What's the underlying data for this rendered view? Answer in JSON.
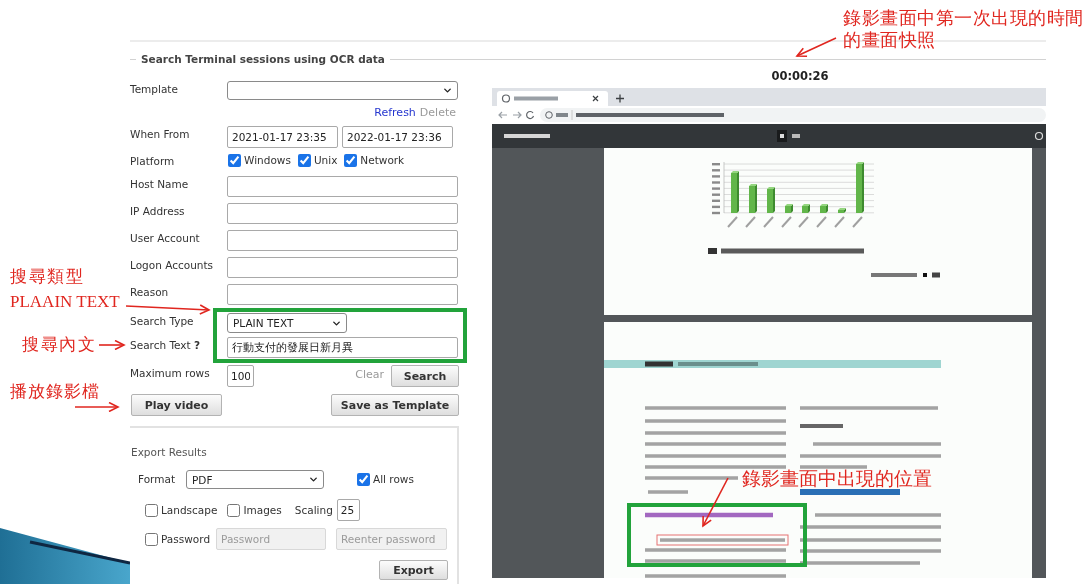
{
  "panel": {
    "title": "Search Terminal sessions using OCR data"
  },
  "form": {
    "fields": [
      {
        "kind": "select",
        "label": "Template",
        "highlighted": false
      },
      {
        "kind": "links",
        "links": [
          {
            "label": "Refresh",
            "disabled": false
          },
          {
            "label": "Delete",
            "disabled": true
          }
        ],
        "highlighted": false
      },
      {
        "kind": "date_range",
        "label": "When From",
        "values": [
          "2021-01-17 23:35",
          "2022-01-17 23:36"
        ],
        "highlighted": false
      },
      {
        "kind": "checkboxes",
        "label": "Platform",
        "options": [
          {
            "label": "Windows",
            "checked": true
          },
          {
            "label": "Unix",
            "checked": true
          },
          {
            "label": "Network",
            "checked": true
          }
        ],
        "highlighted": false
      },
      {
        "kind": "text",
        "label": "Host Name",
        "highlighted": false
      },
      {
        "kind": "text",
        "label": "IP Address",
        "highlighted": false
      },
      {
        "kind": "text",
        "label": "User Account",
        "highlighted": false
      },
      {
        "kind": "text",
        "label": "Logon Accounts",
        "highlighted": false
      },
      {
        "kind": "text",
        "label": "Reason",
        "highlighted": false
      },
      {
        "kind": "select",
        "label": "Search Type",
        "value": "PLAIN TEXT",
        "highlighted": true
      },
      {
        "kind": "text",
        "label": "Search Text **?**",
        "value": "行動支付的發展日新月異",
        "highlighted": true
      },
      {
        "kind": "max_rows",
        "label": "Maximum rows",
        "value": "100",
        "link": {
          "label": "Clear",
          "disabled": true
        },
        "button": "Search",
        "highlighted": false
      }
    ],
    "buttons": [
      {
        "label": "Play video"
      },
      {
        "label": "Save as Template"
      }
    ]
  },
  "export": {
    "title": "Export Results",
    "format": {
      "label": "Format",
      "value": "PDF"
    },
    "all_rows": {
      "label": "All rows",
      "checked": true
    },
    "options": [
      {
        "label": "Landscape",
        "checked": false
      },
      {
        "label": "Images",
        "checked": false
      }
    ],
    "scaling": {
      "label": "Scaling",
      "value": "25"
    },
    "password": {
      "label": "Password",
      "checked": false
    },
    "password_fields": [
      {
        "placeholder": "Password",
        "disabled": true
      },
      {
        "placeholder": "Reenter password",
        "disabled": true
      }
    ],
    "button": "Export"
  },
  "video": {
    "timestamp": "00:00:26"
  },
  "annotations": [
    {
      "text": "錄影畫面中第一次出現的時間的畫面快照"
    },
    {
      "text": "搜尋類型"
    },
    {
      "text": "PLAAIN TEXT"
    },
    {
      "text": "搜尋內文"
    },
    {
      "text": "播放錄影檔"
    },
    {
      "text": "錄影畫面中出現的位置"
    }
  ]
}
